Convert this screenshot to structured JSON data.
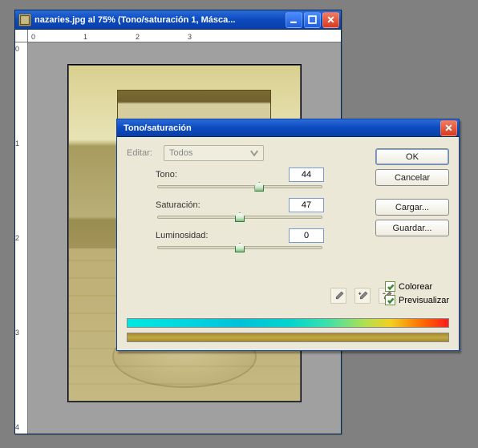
{
  "doc": {
    "title": "nazaries.jpg al 75% (Tono/saturación 1, Másca...",
    "ruler_h": [
      "0",
      "1",
      "2",
      "3"
    ],
    "ruler_v": [
      "0",
      "1",
      "2",
      "3",
      "4"
    ]
  },
  "dialog": {
    "title": "Tono/saturación",
    "edit_label": "Editar:",
    "edit_value": "Todos",
    "sliders": {
      "hue": {
        "label": "Tono:",
        "value": "44",
        "pct": 62
      },
      "saturation": {
        "label": "Saturación:",
        "value": "47",
        "pct": 50
      },
      "lightness": {
        "label": "Luminosidad:",
        "value": "0",
        "pct": 50
      }
    },
    "buttons": {
      "ok": "OK",
      "cancel": "Cancelar",
      "load": "Cargar...",
      "save": "Guardar..."
    },
    "checks": {
      "colorize": "Colorear",
      "preview": "Previsualizar"
    }
  }
}
